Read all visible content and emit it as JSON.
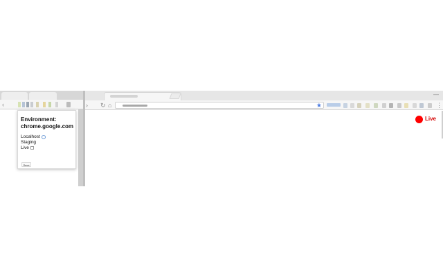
{
  "popup": {
    "heading_label": "Environment:",
    "heading_domain": "chrome.google.com",
    "environments": [
      {
        "label": "Localhost",
        "control": "radio",
        "checked": true
      },
      {
        "label": "Staging",
        "control": "none",
        "checked": false
      },
      {
        "label": "Live",
        "control": "checkbox",
        "checked": false
      }
    ],
    "save_label": "Save"
  },
  "badge": {
    "label": "Live",
    "color": "#ff0000"
  },
  "browser": {
    "tab_close_glyph": "×",
    "star_color": "#4a7ae0"
  }
}
